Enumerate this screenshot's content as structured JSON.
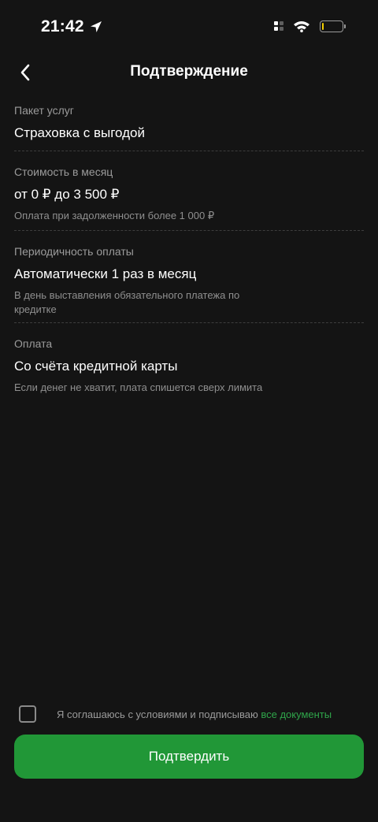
{
  "status_bar": {
    "time": "21:42",
    "location_icon": "location-arrow-icon",
    "signal_icon": "signal-icon",
    "wifi_icon": "wifi-icon",
    "battery_icon": "battery-icon",
    "battery_level": 0.1,
    "battery_color": "#f5d000"
  },
  "header": {
    "back_icon": "chevron-left-icon",
    "title": "Подтверждение"
  },
  "sections": [
    {
      "label": "Пакет услуг",
      "value": "Страховка с выгодой"
    },
    {
      "label": "Стоимость в месяц",
      "value": "от 0 ₽ до 3 500 ₽",
      "note": "Оплата при задолженности более 1 000 ₽"
    },
    {
      "label": "Периодичность оплаты",
      "value": "Автоматически 1 раз в месяц",
      "note": "В день выставления обязательного платежа по кредитке"
    },
    {
      "label": "Оплата",
      "value": "Со счёта кредитной карты",
      "note": "Если денег не хватит, плата спишется сверх лимита"
    }
  ],
  "agreement": {
    "checked": false,
    "text": "Я соглашаюсь с условиями и подписываю",
    "link": "все документы"
  },
  "confirm_button": {
    "label": "Подтвердить"
  },
  "colors": {
    "background": "#141414",
    "accent": "#219737",
    "link": "#2fa54a"
  }
}
